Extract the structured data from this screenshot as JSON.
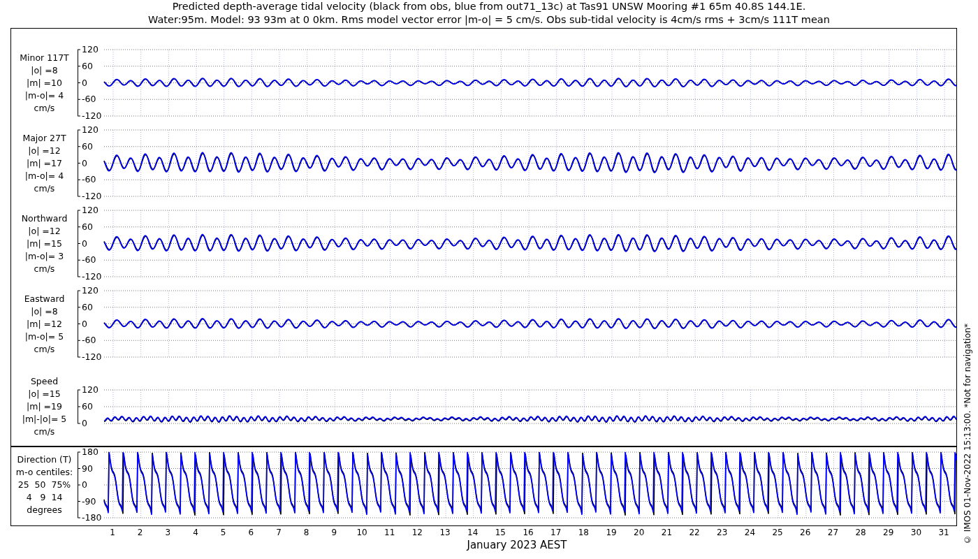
{
  "title_lines": [
    "Predicted depth-average tidal velocity (black from obs, blue from out71_13c) at Tas91 UNSW Mooring #1 65m 40.8S 144.1E.",
    "Water:95m. Model: 93 93m at 0 0km. Rms model vector error |m-o| = 5 cm/s. Obs sub-tidal velocity is 4cm/s rms + 3cm/s 111T mean"
  ],
  "panels": [
    {
      "kind": "minor",
      "label_lines": [
        "Minor 117T",
        "|o| =8",
        "|m| =10",
        "|m-o|= 4",
        "cm/s"
      ],
      "yticks": [
        "120",
        "60",
        "0",
        "-60",
        "-120"
      ]
    },
    {
      "kind": "major",
      "label_lines": [
        "Major 27T",
        "|o| =12",
        "|m| =17",
        "|m-o|= 4",
        "cm/s"
      ],
      "yticks": [
        "120",
        "60",
        "0",
        "-60",
        "-120"
      ]
    },
    {
      "kind": "north",
      "label_lines": [
        "Northward",
        "|o| =12",
        "|m| =15",
        "|m-o|= 3",
        "cm/s"
      ],
      "yticks": [
        "120",
        "60",
        "0",
        "-60",
        "-120"
      ]
    },
    {
      "kind": "east",
      "label_lines": [
        "Eastward",
        "|o| =8",
        "|m| =12",
        "|m-o|= 5",
        "cm/s"
      ],
      "yticks": [
        "120",
        "60",
        "0",
        "-60",
        "-120"
      ]
    },
    {
      "kind": "speed",
      "label_lines": [
        "Speed",
        "|o| =15",
        "|m| =19",
        "|m|-|o|= 5",
        "cm/s"
      ],
      "yticks": [
        "120",
        "60",
        "0"
      ]
    },
    {
      "kind": "direction",
      "label_lines": [
        "Direction (T)",
        "m-o centiles:",
        "25  50  75%",
        "4   9  14",
        "degrees"
      ],
      "yticks": [
        "180",
        "90",
        "0",
        "-90",
        "-180"
      ]
    }
  ],
  "xticks": [
    "1",
    "2",
    "3",
    "4",
    "5",
    "6",
    "7",
    "8",
    "9",
    "10",
    "11",
    "12",
    "13",
    "14",
    "15",
    "16",
    "17",
    "18",
    "19",
    "20",
    "21",
    "22",
    "23",
    "24",
    "25",
    "26",
    "27",
    "28",
    "29",
    "30",
    "31"
  ],
  "xlabel": "January 2023 AEST",
  "footer_note": "© IMOS 01-Nov-2022 15:13:00. *Not for navigation*"
}
